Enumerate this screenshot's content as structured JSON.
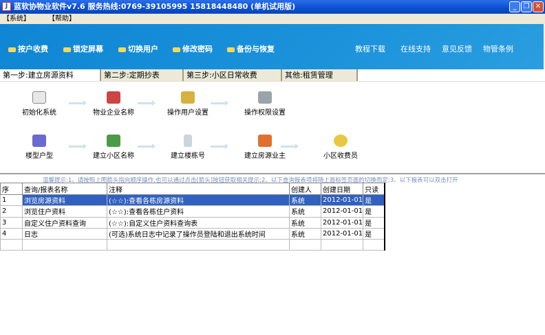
{
  "title": "蓝软协物业软件v7.6 服务热线:0769-39105995 15818448480 (单机试用版)",
  "window_buttons": {
    "minimize": "_",
    "restore": "❐",
    "close": "✕"
  },
  "menu": [
    "【系统】",
    "【帮助】"
  ],
  "toolbar_left": [
    "按户收费",
    "锁定屏幕",
    "切换用户",
    "修改密码",
    "备份与恢复"
  ],
  "toolbar_right": [
    "教程下载",
    "在线支持",
    "意见反馈",
    "物管条例"
  ],
  "tabs": [
    "第一步:建立房源资料",
    "第二步:定期抄表",
    "第三步:小区日常收费",
    "其他:租赁管理"
  ],
  "flow_row1": [
    "初始化系统",
    "物业企业名称",
    "操作用户设置",
    "操作权限设置"
  ],
  "flow_row2": [
    "楼型户型",
    "建立小区名称",
    "建立楼栋号",
    "建立房源业主",
    "小区收费员"
  ],
  "hint": "温馨提示:1、请按照上图箭头指向顺序操作,也可以通过点击[箭头]按钮获取相关提示;2、以下查询报表项将随上面标签页面的切换而定;3、以下报表可以双击打开",
  "grid": {
    "headers": [
      "序",
      "查询/报表名称",
      "注释",
      "创建人",
      "创建日期",
      "只读"
    ],
    "rows": [
      [
        "1",
        "浏览房源资料",
        "(☆☆):查看各栋房源资料",
        "系统",
        "2012-01-01",
        "是"
      ],
      [
        "2",
        "浏览住户资料",
        "(☆☆):查看各栋住户资料",
        "系统",
        "2012-01-01",
        "是"
      ],
      [
        "3",
        "自定义住户资料查询",
        "(☆☆):自定义住户资料查询表",
        "系统",
        "2012-01-01",
        "是"
      ],
      [
        "4",
        "日志",
        "(可选)系统日志中记录了操作员登陆和退出系统时间",
        "系统",
        "2012-01-01",
        "是"
      ]
    ]
  }
}
